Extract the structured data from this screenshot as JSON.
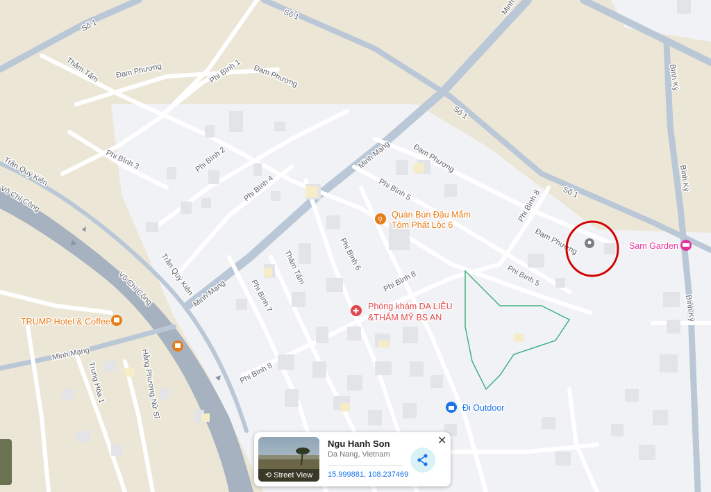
{
  "map": {
    "colors": {
      "land": "#ece6d6",
      "area": "#f1f2f5",
      "road": "#ffffff",
      "major_road": "#b9c7d6",
      "river": "#a6b2bf",
      "building": "#e2e4e8",
      "park": "#3fb27f",
      "highlight": "#d40000"
    },
    "street_labels": [
      "Số 1",
      "Số 1",
      "Số 1",
      "Số 1",
      "Thăm Tấm",
      "Đạm Phương",
      "Phi Bình 1",
      "Đạm Phương",
      "Phi Bình 2",
      "Phi Bình 3",
      "Trần Quý Kiên",
      "Võ Chí Công",
      "Minh Mạng",
      "Phi Bình 4",
      "Đạm Phương",
      "Phi Bình 5",
      "Phi Bình 8",
      "Đạm Phương",
      "Phi Bình 5",
      "Bình Kỳ",
      "Bình Kỳ",
      "Bình Kỳ",
      "Trần Quý Kiên",
      "Thăm Tấm",
      "Phi Bình 6",
      "Phi Bình 7",
      "Minh Mạng",
      "Phi Bình 8",
      "Võ Chí Công",
      "Minh Mạng",
      "Trung Hòa 1",
      "Hằng Phương Nữ Sĩ",
      "Phi Bình 8",
      "Minh"
    ],
    "pois": [
      {
        "name": "Quán Bún Đậu Mắm Tôm Phát Lộc 6",
        "line1": "Quán Bún Đậu Mắm",
        "line2": "Tôm Phất Lộc 6",
        "icon": "restaurant-icon",
        "color": "#e67c17"
      },
      {
        "name": "Phòng khám DA LIỄU &THẨM MỸ BS AN",
        "line1": "Phòng khám DA LIỄU",
        "line2": "&THẨM MỸ BS AN",
        "icon": "hospital-icon",
        "color": "#e0484b"
      },
      {
        "name": "Sam Garden",
        "line1": "Sam Garden",
        "icon": "hotel-icon",
        "color": "#e4339b"
      },
      {
        "name": "TRUMP Hotel & Coffee",
        "line1": "TRUMP Hotel & Coffee",
        "icon": "cafe-icon",
        "color": "#e67c17"
      },
      {
        "name": "Đi Outdoor",
        "line1": "Đi Outdoor",
        "icon": "shopping-icon",
        "color": "#1a73e8"
      }
    ]
  },
  "place_card": {
    "title": "Ngu Hanh Son",
    "subtitle": "Da Nang, Vietnam",
    "coordinates": "15.999881, 108.237469",
    "street_view_label": "Street View",
    "close_label": "✕"
  }
}
